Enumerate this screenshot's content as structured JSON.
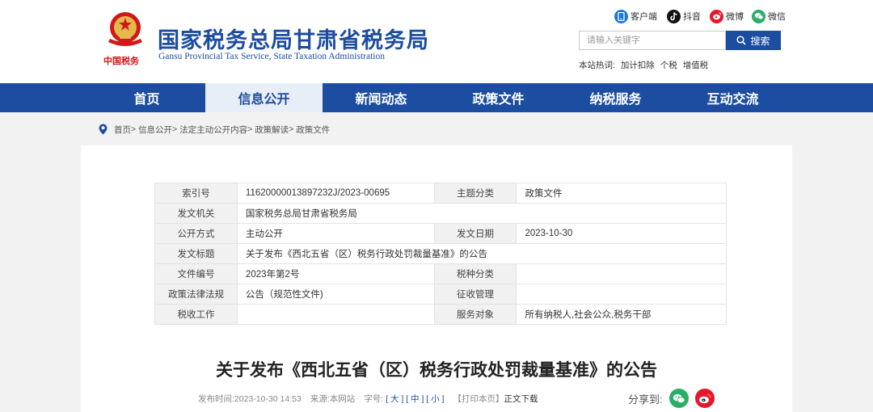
{
  "header": {
    "title": "国家税务总局甘肃省税务局",
    "subtitle": "Gansu Provincial Tax Service, State Taxation Administration",
    "logo_text": "中国税务",
    "social": [
      {
        "label": "客户端",
        "icon": "mobile-client-icon",
        "color": "#1c7ad6"
      },
      {
        "label": "抖音",
        "icon": "douyin-icon",
        "color": "#111111"
      },
      {
        "label": "微博",
        "icon": "weibo-icon",
        "color": "#e6162d"
      },
      {
        "label": "微信",
        "icon": "wechat-icon",
        "color": "#2aae67"
      }
    ],
    "search": {
      "placeholder": "请输入关键字",
      "button": "搜索"
    },
    "hot": {
      "label": "本站热词:",
      "words": [
        "加计扣除",
        "个税",
        "增值税"
      ]
    }
  },
  "nav": {
    "items": [
      "首页",
      "信息公开",
      "新闻动态",
      "政策文件",
      "纳税服务",
      "互动交流"
    ],
    "active_index": 1
  },
  "breadcrumb": [
    "首页",
    "信息公开",
    "法定主动公开内容",
    "政策解读",
    "政策文件"
  ],
  "meta_table": [
    {
      "k1": "索引号",
      "v1": "11620000013897232J/2023-00695",
      "k2": "主题分类",
      "v2": "政策文件"
    },
    {
      "k1": "发文机关",
      "v1": "国家税务总局甘肃省税务局"
    },
    {
      "k1": "公开方式",
      "v1": "主动公开",
      "k2": "发文日期",
      "v2": "2023-10-30"
    },
    {
      "k1": "发文标题",
      "v1": "关于发布《西北五省（区）税务行政处罚裁量基准》的公告"
    },
    {
      "k1": "文件编号",
      "v1": "2023年第2号",
      "k2": "税种分类",
      "v2": ""
    },
    {
      "k1": "政策法律法规",
      "v1": "公告（规范性文件)",
      "k2": "征收管理",
      "v2": ""
    },
    {
      "k1": "税收工作",
      "v1": "",
      "k2": "服务对象",
      "v2": "所有纳税人,社会公众,税务干部"
    }
  ],
  "article": {
    "title": "关于发布《西北五省（区）税务行政处罚裁量基准》的公告",
    "published_label": "发布时间:",
    "published": "2023-10-30 14:53",
    "source_label": "来源:",
    "source": "本网站",
    "fontsize_label": "字号:",
    "size_large": "大",
    "size_medium": "中",
    "size_small": "小",
    "print": "【打印本页】",
    "download": "正文下载",
    "share_label": "分享到:"
  },
  "colors": {
    "brand": "#1c4da0",
    "nav_active_bg": "#e8eef7",
    "accent_red": "#d01818"
  }
}
